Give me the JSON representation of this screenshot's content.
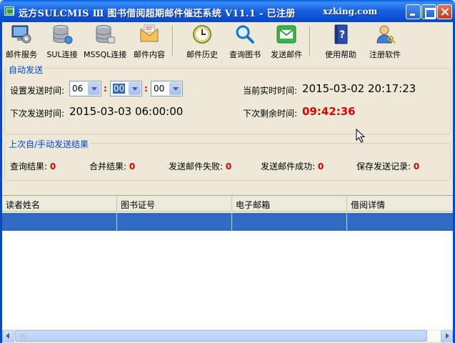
{
  "window": {
    "title": "远方SULCMIS Ⅲ 图书借阅超期邮件催还系统 V11.1 - 已注册",
    "site": "xzking.com"
  },
  "toolbar": [
    {
      "label": "邮件服务",
      "icon": "gear-monitor-icon"
    },
    {
      "label": "SUL连接",
      "icon": "database-icon"
    },
    {
      "label": "MSSQL连接",
      "icon": "database-icon"
    },
    {
      "label": "邮件内容",
      "icon": "envelope-icon"
    },
    {
      "label": "邮件历史",
      "icon": "clock-icon"
    },
    {
      "label": "查询图书",
      "icon": "magnifier-icon"
    },
    {
      "label": "发送邮件",
      "icon": "send-mail-icon"
    },
    {
      "label": "使用帮助",
      "icon": "help-book-icon"
    },
    {
      "label": "注册软件",
      "icon": "user-key-icon"
    }
  ],
  "auto_send": {
    "title": "自动发送",
    "set_time_label": "设置发送时间:",
    "hour": "06",
    "minute": "00",
    "second": "00",
    "colon": ":",
    "current_time_label": "当前实时时间:",
    "current_time": "2015-03-02 20:17:23",
    "next_send_label": "下次发送时间:",
    "next_send": "2015-03-03 06:00:00",
    "remaining_label": "下次剩余时间:",
    "remaining": "09:42:36"
  },
  "results": {
    "title": "上次自/手动发送结果",
    "items": [
      {
        "label": "查询结果:",
        "value": "0"
      },
      {
        "label": "合并结果:",
        "value": "0"
      },
      {
        "label": "发送邮件失败:",
        "value": "0"
      },
      {
        "label": "发送邮件成功:",
        "value": "0"
      },
      {
        "label": "保存发送记录:",
        "value": "0"
      }
    ]
  },
  "table": {
    "columns": [
      "读者姓名",
      "图书证号",
      "电子邮箱",
      "借阅详情"
    ]
  },
  "colors": {
    "accent": "#0046d5",
    "alert": "#e00000",
    "selection": "#316ac5"
  }
}
